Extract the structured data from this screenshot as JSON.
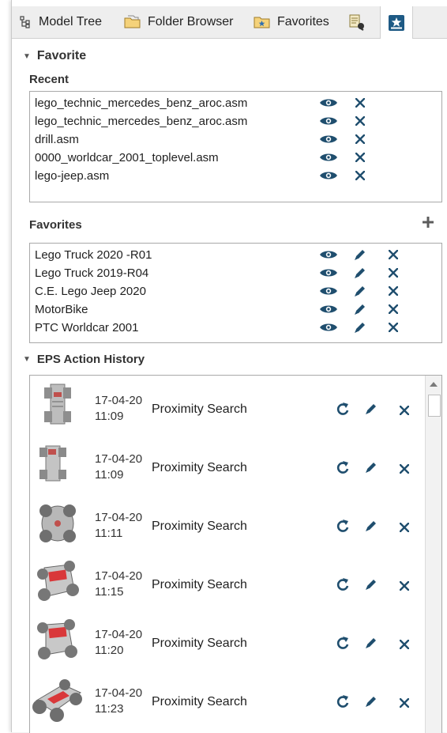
{
  "tabs": {
    "model_tree": "Model Tree",
    "folder_browser": "Folder Browser",
    "favorites": "Favorites"
  },
  "favorite_section": {
    "title": "Favorite",
    "recent_label": "Recent",
    "recent": [
      "lego_technic_mercedes_benz_aroc.asm",
      "lego_technic_mercedes_benz_aroc.asm",
      "drill.asm",
      "0000_worldcar_2001_toplevel.asm",
      "lego-jeep.asm"
    ],
    "favorites_label": "Favorites",
    "favorites": [
      "Lego Truck 2020 -R01",
      "Lego Truck 2019-R04",
      "C.E. Lego Jeep 2020",
      "MotorBike",
      "PTC Worldcar 2001"
    ]
  },
  "history_section": {
    "title": "EPS Action History",
    "items": [
      {
        "date": "17-04-20",
        "time": "11:09",
        "label": "Proximity Search"
      },
      {
        "date": "17-04-20",
        "time": "11:09",
        "label": "Proximity Search"
      },
      {
        "date": "17-04-20",
        "time": "11:11",
        "label": "Proximity Search"
      },
      {
        "date": "17-04-20",
        "time": "11:15",
        "label": "Proximity Search"
      },
      {
        "date": "17-04-20",
        "time": "11:20",
        "label": "Proximity Search"
      },
      {
        "date": "17-04-20",
        "time": "11:23",
        "label": "Proximity Search"
      }
    ]
  },
  "colors": {
    "icon_blue": "#1f4e6e",
    "panel_bg": "#eeeeee",
    "border": "#a9a9a9"
  }
}
